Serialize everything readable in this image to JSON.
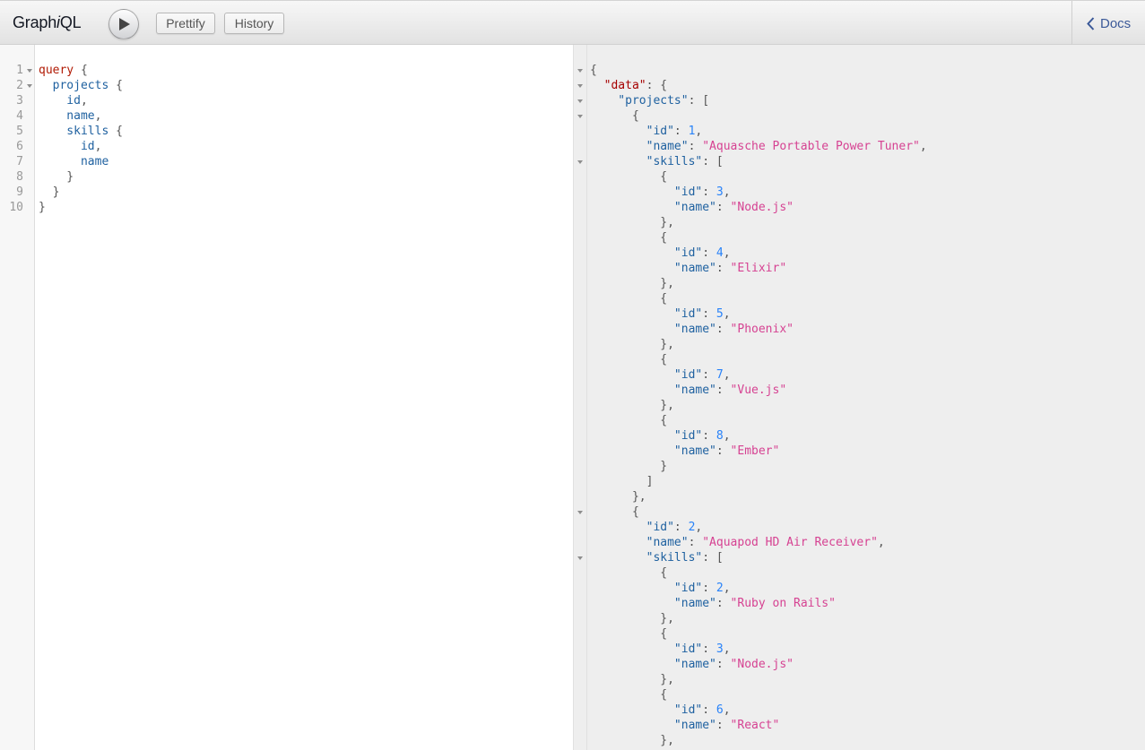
{
  "app": {
    "title_prefix": "Graph",
    "title_italic": "i",
    "title_suffix": "QL"
  },
  "toolbar": {
    "run_icon": "play-icon",
    "prettify_label": "Prettify",
    "history_label": "History",
    "docs_label": "Docs",
    "docs_icon": "chevron-left-icon"
  },
  "query_editor": {
    "line_numbers": [
      "1",
      "2",
      "3",
      "4",
      "5",
      "6",
      "7",
      "8",
      "9",
      "10"
    ],
    "lines": [
      [
        {
          "t": "query",
          "c": "kw"
        },
        {
          "t": " {",
          "c": "punc"
        }
      ],
      [
        {
          "t": "  projects",
          "c": "def"
        },
        {
          "t": " {",
          "c": "punc"
        }
      ],
      [
        {
          "t": "    id",
          "c": "def"
        },
        {
          "t": ",",
          "c": "punc"
        }
      ],
      [
        {
          "t": "    name",
          "c": "def"
        },
        {
          "t": ",",
          "c": "punc"
        }
      ],
      [
        {
          "t": "    skills",
          "c": "def"
        },
        {
          "t": " {",
          "c": "punc"
        }
      ],
      [
        {
          "t": "      id",
          "c": "def"
        },
        {
          "t": ",",
          "c": "punc"
        }
      ],
      [
        {
          "t": "      name",
          "c": "def"
        }
      ],
      [
        {
          "t": "    }",
          "c": "punc"
        }
      ],
      [
        {
          "t": "  }",
          "c": "punc"
        }
      ],
      [
        {
          "t": "}",
          "c": "punc"
        }
      ]
    ]
  },
  "result_viewer": {
    "lines": [
      [
        {
          "t": "{",
          "c": "punc"
        }
      ],
      [
        {
          "t": "  \"data\"",
          "c": "attr"
        },
        {
          "t": ": {",
          "c": "punc"
        }
      ],
      [
        {
          "t": "    \"projects\"",
          "c": "prop"
        },
        {
          "t": ": [",
          "c": "punc"
        }
      ],
      [
        {
          "t": "      {",
          "c": "punc"
        }
      ],
      [
        {
          "t": "        \"id\"",
          "c": "prop"
        },
        {
          "t": ": ",
          "c": "punc"
        },
        {
          "t": "1",
          "c": "num"
        },
        {
          "t": ",",
          "c": "punc"
        }
      ],
      [
        {
          "t": "        \"name\"",
          "c": "prop"
        },
        {
          "t": ": ",
          "c": "punc"
        },
        {
          "t": "\"Aquasche Portable Power Tuner\"",
          "c": "str"
        },
        {
          "t": ",",
          "c": "punc"
        }
      ],
      [
        {
          "t": "        \"skills\"",
          "c": "prop"
        },
        {
          "t": ": [",
          "c": "punc"
        }
      ],
      [
        {
          "t": "          {",
          "c": "punc"
        }
      ],
      [
        {
          "t": "            \"id\"",
          "c": "prop"
        },
        {
          "t": ": ",
          "c": "punc"
        },
        {
          "t": "3",
          "c": "num"
        },
        {
          "t": ",",
          "c": "punc"
        }
      ],
      [
        {
          "t": "            \"name\"",
          "c": "prop"
        },
        {
          "t": ": ",
          "c": "punc"
        },
        {
          "t": "\"Node.js\"",
          "c": "str"
        }
      ],
      [
        {
          "t": "          },",
          "c": "punc"
        }
      ],
      [
        {
          "t": "          {",
          "c": "punc"
        }
      ],
      [
        {
          "t": "            \"id\"",
          "c": "prop"
        },
        {
          "t": ": ",
          "c": "punc"
        },
        {
          "t": "4",
          "c": "num"
        },
        {
          "t": ",",
          "c": "punc"
        }
      ],
      [
        {
          "t": "            \"name\"",
          "c": "prop"
        },
        {
          "t": ": ",
          "c": "punc"
        },
        {
          "t": "\"Elixir\"",
          "c": "str"
        }
      ],
      [
        {
          "t": "          },",
          "c": "punc"
        }
      ],
      [
        {
          "t": "          {",
          "c": "punc"
        }
      ],
      [
        {
          "t": "            \"id\"",
          "c": "prop"
        },
        {
          "t": ": ",
          "c": "punc"
        },
        {
          "t": "5",
          "c": "num"
        },
        {
          "t": ",",
          "c": "punc"
        }
      ],
      [
        {
          "t": "            \"name\"",
          "c": "prop"
        },
        {
          "t": ": ",
          "c": "punc"
        },
        {
          "t": "\"Phoenix\"",
          "c": "str"
        }
      ],
      [
        {
          "t": "          },",
          "c": "punc"
        }
      ],
      [
        {
          "t": "          {",
          "c": "punc"
        }
      ],
      [
        {
          "t": "            \"id\"",
          "c": "prop"
        },
        {
          "t": ": ",
          "c": "punc"
        },
        {
          "t": "7",
          "c": "num"
        },
        {
          "t": ",",
          "c": "punc"
        }
      ],
      [
        {
          "t": "            \"name\"",
          "c": "prop"
        },
        {
          "t": ": ",
          "c": "punc"
        },
        {
          "t": "\"Vue.js\"",
          "c": "str"
        }
      ],
      [
        {
          "t": "          },",
          "c": "punc"
        }
      ],
      [
        {
          "t": "          {",
          "c": "punc"
        }
      ],
      [
        {
          "t": "            \"id\"",
          "c": "prop"
        },
        {
          "t": ": ",
          "c": "punc"
        },
        {
          "t": "8",
          "c": "num"
        },
        {
          "t": ",",
          "c": "punc"
        }
      ],
      [
        {
          "t": "            \"name\"",
          "c": "prop"
        },
        {
          "t": ": ",
          "c": "punc"
        },
        {
          "t": "\"Ember\"",
          "c": "str"
        }
      ],
      [
        {
          "t": "          }",
          "c": "punc"
        }
      ],
      [
        {
          "t": "        ]",
          "c": "punc"
        }
      ],
      [
        {
          "t": "      },",
          "c": "punc"
        }
      ],
      [
        {
          "t": "      {",
          "c": "punc"
        }
      ],
      [
        {
          "t": "        \"id\"",
          "c": "prop"
        },
        {
          "t": ": ",
          "c": "punc"
        },
        {
          "t": "2",
          "c": "num"
        },
        {
          "t": ",",
          "c": "punc"
        }
      ],
      [
        {
          "t": "        \"name\"",
          "c": "prop"
        },
        {
          "t": ": ",
          "c": "punc"
        },
        {
          "t": "\"Aquapod HD Air Receiver\"",
          "c": "str"
        },
        {
          "t": ",",
          "c": "punc"
        }
      ],
      [
        {
          "t": "        \"skills\"",
          "c": "prop"
        },
        {
          "t": ": [",
          "c": "punc"
        }
      ],
      [
        {
          "t": "          {",
          "c": "punc"
        }
      ],
      [
        {
          "t": "            \"id\"",
          "c": "prop"
        },
        {
          "t": ": ",
          "c": "punc"
        },
        {
          "t": "2",
          "c": "num"
        },
        {
          "t": ",",
          "c": "punc"
        }
      ],
      [
        {
          "t": "            \"name\"",
          "c": "prop"
        },
        {
          "t": ": ",
          "c": "punc"
        },
        {
          "t": "\"Ruby on Rails\"",
          "c": "str"
        }
      ],
      [
        {
          "t": "          },",
          "c": "punc"
        }
      ],
      [
        {
          "t": "          {",
          "c": "punc"
        }
      ],
      [
        {
          "t": "            \"id\"",
          "c": "prop"
        },
        {
          "t": ": ",
          "c": "punc"
        },
        {
          "t": "3",
          "c": "num"
        },
        {
          "t": ",",
          "c": "punc"
        }
      ],
      [
        {
          "t": "            \"name\"",
          "c": "prop"
        },
        {
          "t": ": ",
          "c": "punc"
        },
        {
          "t": "\"Node.js\"",
          "c": "str"
        }
      ],
      [
        {
          "t": "          },",
          "c": "punc"
        }
      ],
      [
        {
          "t": "          {",
          "c": "punc"
        }
      ],
      [
        {
          "t": "            \"id\"",
          "c": "prop"
        },
        {
          "t": ": ",
          "c": "punc"
        },
        {
          "t": "6",
          "c": "num"
        },
        {
          "t": ",",
          "c": "punc"
        }
      ],
      [
        {
          "t": "            \"name\"",
          "c": "prop"
        },
        {
          "t": ": ",
          "c": "punc"
        },
        {
          "t": "\"React\"",
          "c": "str"
        }
      ],
      [
        {
          "t": "          },",
          "c": "punc"
        }
      ]
    ]
  },
  "colors": {
    "keyword": "#b11a04",
    "field": "#1f61a0",
    "string": "#d64292",
    "number": "#2882f9",
    "data_key": "#a60000",
    "link": "#3b5998"
  }
}
